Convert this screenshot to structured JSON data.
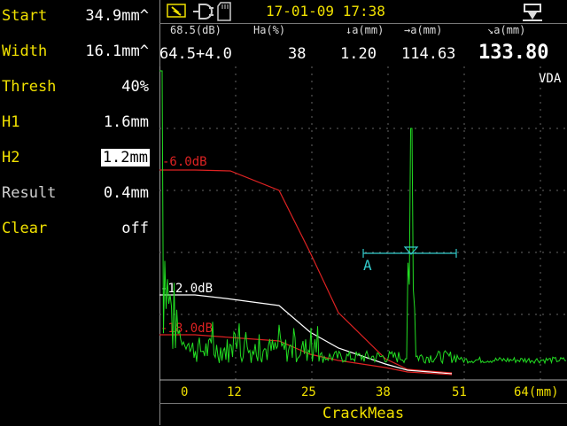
{
  "menu": {
    "items": [
      {
        "label": "Start",
        "value": "34.9mm^",
        "label_color": "yellow",
        "selected": false
      },
      {
        "label": "Width",
        "value": "16.1mm^",
        "label_color": "yellow",
        "selected": false
      },
      {
        "label": "Thresh",
        "value": "40%",
        "label_color": "yellow",
        "selected": false
      },
      {
        "label": "H1",
        "value": "1.6mm",
        "label_color": "yellow",
        "selected": false
      },
      {
        "label": "H2",
        "value": "1.2mm",
        "label_color": "yellow",
        "selected": true
      },
      {
        "label": "Result",
        "value": "0.4mm",
        "label_color": "grey",
        "selected": false
      },
      {
        "label": "Clear",
        "value": "off",
        "label_color": "yellow",
        "selected": false
      }
    ]
  },
  "status": {
    "datetime": "17-01-09 17:38",
    "icons": [
      "battery-charging-icon",
      "plug-icon",
      "sd-card-icon",
      "probe-icon"
    ]
  },
  "header": {
    "labels": [
      "68.5(dB)",
      "Ha(%)",
      "↓a(mm)",
      "→a(mm)",
      "↘a(mm)"
    ],
    "values": [
      "64.5+4.0",
      "38",
      "1.20",
      "114.63",
      "133.80"
    ]
  },
  "scope": {
    "mode_label": "VDA",
    "gate_label": "A",
    "curve_labels": [
      "-6.0dB",
      "-12.0dB",
      "-18.0dB"
    ],
    "x_ticks": [
      "0",
      "12",
      "25",
      "38",
      "51",
      "64(mm)"
    ],
    "colors": {
      "signal": "#22dd22",
      "dac_red": "#dd2222",
      "dac_white": "#ffffff",
      "gate": "#33cccc",
      "grid": "#888888"
    }
  },
  "footer": {
    "title": "CrackMeas"
  }
}
